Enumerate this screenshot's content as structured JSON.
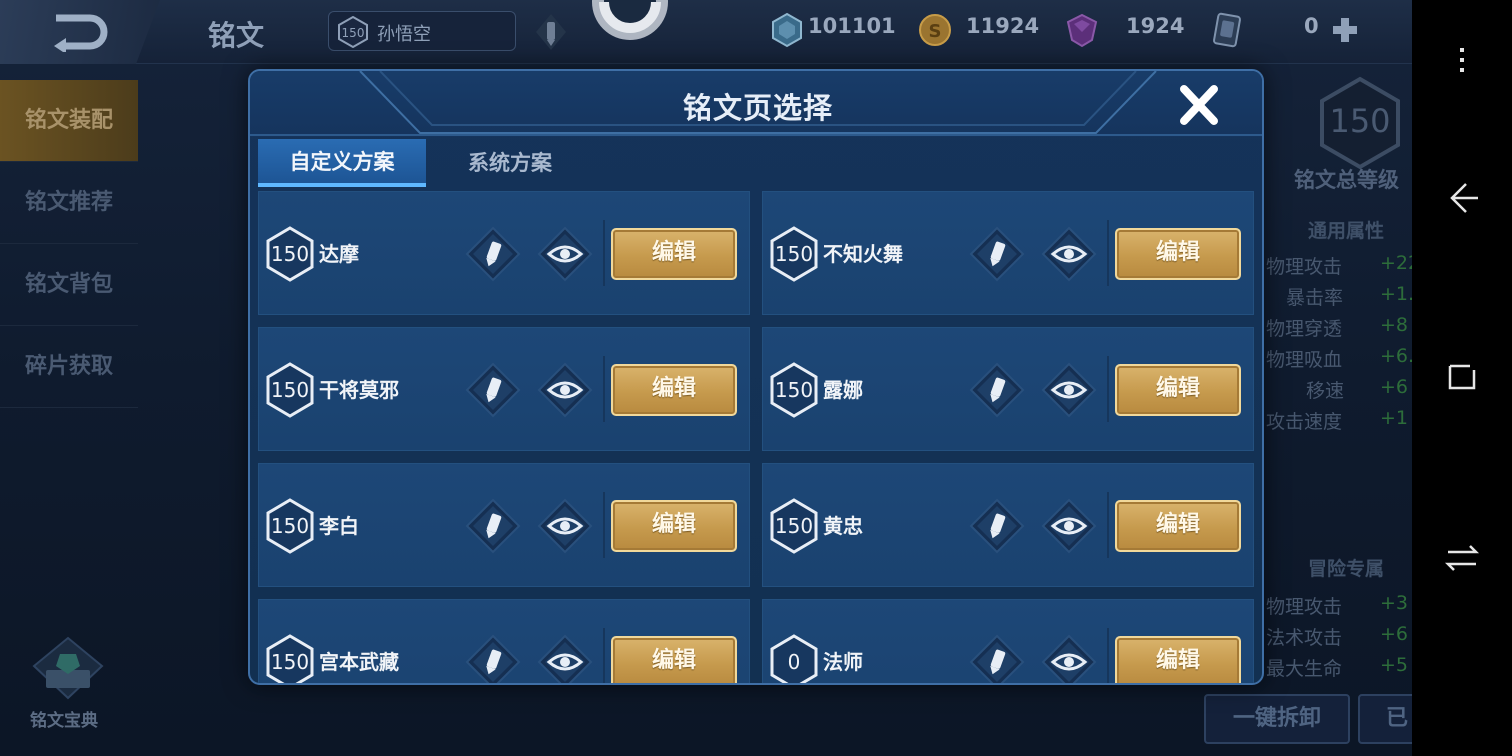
{
  "topbar": {
    "title": "铭文",
    "hero_level": "150",
    "hero_name": "孙悟空",
    "resources": [
      {
        "icon": "diamond-crystal-icon",
        "value": "101101"
      },
      {
        "icon": "gold-coin-icon",
        "value": "11924"
      },
      {
        "icon": "purple-gem-icon",
        "value": "1924"
      },
      {
        "icon": "card-icon",
        "value": "0"
      }
    ]
  },
  "left_menu": {
    "items": [
      "铭文装配",
      "铭文推荐",
      "铭文背包",
      "碎片获取"
    ],
    "active_index": 0,
    "book_label": "铭文宝典"
  },
  "right_panel": {
    "level": "150",
    "title": "铭文总等级",
    "general_title": "通用属性",
    "general_stats": [
      {
        "name": "物理攻击",
        "value": "+22"
      },
      {
        "name": "暴击率",
        "value": "+1."
      },
      {
        "name": "物理穿透",
        "value": "+8"
      },
      {
        "name": "物理吸血",
        "value": "+6."
      },
      {
        "name": "移速",
        "value": "+6"
      },
      {
        "name": "攻击速度",
        "value": "+1"
      }
    ],
    "adventure_title": "冒险专属",
    "adventure_stats": [
      {
        "name": "物理攻击",
        "value": "+3"
      },
      {
        "name": "法术攻击",
        "value": "+6"
      },
      {
        "name": "最大生命",
        "value": "+5"
      }
    ],
    "dismantle_label": "一键拆卸",
    "cut_label": "已"
  },
  "modal": {
    "title": "铭文页选择",
    "tabs": [
      {
        "label": "自定义方案",
        "active": true
      },
      {
        "label": "系统方案",
        "active": false
      }
    ],
    "edit_label": "编辑",
    "pages": [
      {
        "level": "150",
        "name": "达摩"
      },
      {
        "level": "150",
        "name": "不知火舞"
      },
      {
        "level": "150",
        "name": "干将莫邪"
      },
      {
        "level": "150",
        "name": "露娜"
      },
      {
        "level": "150",
        "name": "李白"
      },
      {
        "level": "150",
        "name": "黄忠"
      },
      {
        "level": "150",
        "name": "宫本武藏"
      },
      {
        "level": "0",
        "name": "法师"
      }
    ]
  },
  "colors": {
    "modal_bg": "#15335a",
    "card_bg": "#1d4777",
    "tab_active": "#2a6cb3",
    "edit_button": "#c69a4d",
    "accent_blue": "#5fb8ff"
  },
  "navbar": {
    "icons": [
      "menu-dots-icon",
      "back-arrow-icon",
      "recent-apps-icon",
      "switch-icon"
    ]
  }
}
